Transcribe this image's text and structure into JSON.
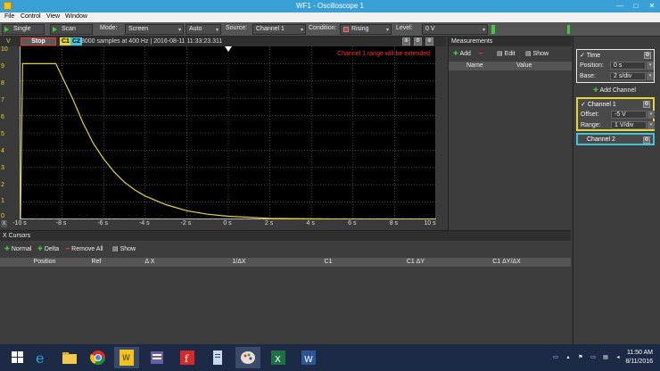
{
  "window": {
    "title": "WF1 - Oscilloscope 1",
    "minimize": "—",
    "maximize": "□",
    "close": "✕"
  },
  "menu": [
    "File",
    "Control",
    "View",
    "Window"
  ],
  "toolbar": {
    "single": "Single",
    "scan": "Scan",
    "mode_label": "Mode:",
    "mode_value": "Screen",
    "auto_value": "Auto",
    "source_label": "Source:",
    "source_value": "Channel 1",
    "condition_label": "Condition:",
    "condition_value": "Rising",
    "level_label": "Level:",
    "level_value": "0 V",
    "dropdown": "▾"
  },
  "scope": {
    "y_unit": "V",
    "stop": "Stop",
    "c1": "C1",
    "c2": "C2",
    "info": "8000 samples at 400 Hz | 2016-08-11 11:33:23.311",
    "warning": "Channel 1 range will be extended",
    "x_button": "X",
    "y_ticks": [
      "10",
      "9",
      "8",
      "7",
      "6",
      "5",
      "4",
      "3",
      "2",
      "1",
      "0"
    ],
    "x_ticks": [
      "-10 s",
      "-8 s",
      "-6 s",
      "-4 s",
      "-2 s",
      "0 s",
      "2 s",
      "4 s",
      "6 s",
      "8 s",
      "10 s"
    ],
    "head_icons": [
      "⊕",
      "⚙",
      "⊗"
    ]
  },
  "chart_data": {
    "type": "line",
    "title": "",
    "xlabel": "",
    "ylabel": "V",
    "xlim": [
      -10,
      10
    ],
    "ylim": [
      0,
      10
    ],
    "grid": true,
    "series": [
      {
        "name": "C1",
        "color": "#e6d534",
        "x": [
          -10,
          -9.9,
          -8.3,
          -7.5,
          -7.0,
          -6.5,
          -6.0,
          -5.5,
          -5.0,
          -4.5,
          -4.0,
          -3.0,
          -2.0,
          -1.0,
          0,
          2,
          4,
          6,
          8,
          10
        ],
        "y": [
          0,
          9,
          9,
          7.0,
          5.6,
          4.4,
          3.5,
          2.75,
          2.15,
          1.7,
          1.35,
          0.85,
          0.5,
          0.3,
          0.18,
          0.06,
          0.03,
          0.02,
          0.02,
          0.02
        ]
      }
    ]
  },
  "measurements": {
    "title": "Measurements",
    "add": "Add",
    "edit": "Edit",
    "show": "Show",
    "col_name": "Name",
    "col_value": "Value"
  },
  "time": {
    "title": "Time",
    "position_label": "Position:",
    "position_value": "0 s",
    "base_label": "Base:",
    "base_value": "2 s/div"
  },
  "add_channel": "Add Channel",
  "channel1": {
    "title": "Channel 1",
    "offset_label": "Offset:",
    "offset_value": "-5 V",
    "range_label": "Range:",
    "range_value": "1 V/div"
  },
  "channel2": {
    "title": "Channel 2"
  },
  "cursors": {
    "title": "X Cursors",
    "normal": "Normal",
    "delta": "Delta",
    "remove_all": "Remove All",
    "show": "Show",
    "columns": [
      "Position",
      "Ref",
      "Δ X",
      "1/ΔX",
      "C1",
      "C1 ΔY",
      "C1 ΔY/ΔX"
    ]
  },
  "taskbar": {
    "time": "11:50 AM",
    "date": "8/11/2016"
  },
  "colors": {
    "ch1": "#e6d534",
    "ch2": "#3cc6e0",
    "accent": "#39a0d6"
  }
}
